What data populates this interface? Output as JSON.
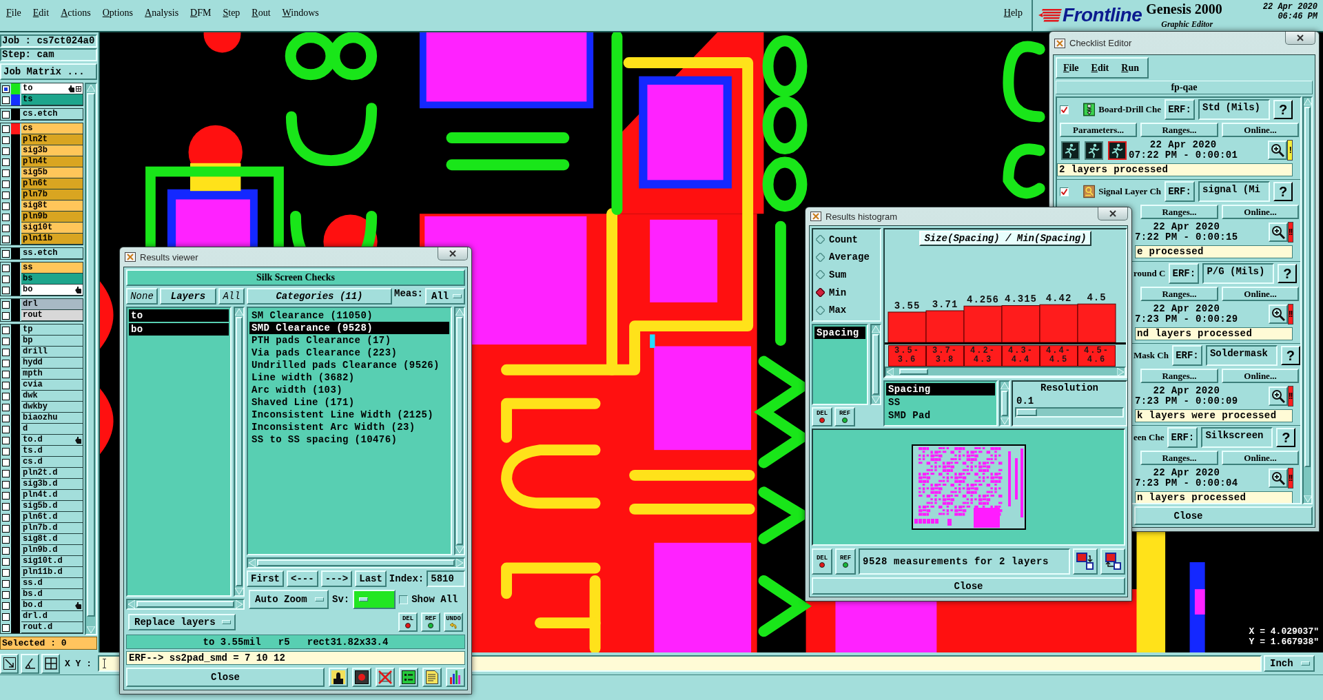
{
  "menu_bar": {
    "items": [
      "File",
      "Edit",
      "Actions",
      "Options",
      "Analysis",
      "DFM",
      "Step",
      "Rout",
      "Windows"
    ],
    "help": "Help"
  },
  "brand": {
    "logo": "Frontline",
    "product": "Genesis 2000",
    "subtitle": "Graphic Editor",
    "date": "22 Apr 2020",
    "time": "06:46 PM"
  },
  "job_panel": {
    "job": "Job : cs7ct024a0",
    "step": "Step: cam",
    "matrix_button": "Job Matrix ...",
    "layer_groups": [
      [
        {
          "name": "to",
          "work": true,
          "swatch": {
            "color": "#19e619"
          },
          "color": "#ffffff",
          "hand": true,
          "grid": true
        },
        {
          "name": "ts",
          "work": false,
          "swatch": {
            "color": "#1430ff"
          },
          "color": "#1ea58c",
          "hand": false,
          "grid": false
        }
      ],
      [
        {
          "name": "cs.etch",
          "work": false,
          "color": "#a3dedb",
          "hand": false,
          "grid": false
        }
      ],
      [
        {
          "name": "cs",
          "work": false,
          "swatch": {
            "color": "#ff1a1a"
          },
          "color": "#ffc65a",
          "hand": false,
          "grid": false
        },
        {
          "name": "pln2t",
          "work": false,
          "color": "#d9a521",
          "hand": false,
          "grid": false
        },
        {
          "name": "sig3b",
          "work": false,
          "color": "#ffc65a",
          "hand": false,
          "grid": false
        },
        {
          "name": "pln4t",
          "work": false,
          "color": "#d9a521",
          "hand": false,
          "grid": false
        },
        {
          "name": "sig5b",
          "work": false,
          "color": "#ffc65a",
          "hand": false,
          "grid": false
        },
        {
          "name": "pln6t",
          "work": false,
          "color": "#d9a521",
          "hand": false,
          "grid": false
        },
        {
          "name": "pln7b",
          "work": false,
          "color": "#d9a521",
          "hand": false,
          "grid": false
        },
        {
          "name": "sig8t",
          "work": false,
          "color": "#ffc65a",
          "hand": false,
          "grid": false
        },
        {
          "name": "pln9b",
          "work": false,
          "color": "#d9a521",
          "hand": false,
          "grid": false
        },
        {
          "name": "sig10t",
          "work": false,
          "color": "#ffc65a",
          "hand": false,
          "grid": false
        },
        {
          "name": "pln11b",
          "work": false,
          "color": "#d9a521",
          "hand": false,
          "grid": false
        }
      ],
      [
        {
          "name": "ss.etch",
          "work": false,
          "color": "#a3dedb",
          "hand": false,
          "grid": false
        }
      ],
      [
        {
          "name": "ss",
          "work": false,
          "color": "#ffc65a",
          "hand": false,
          "grid": false
        },
        {
          "name": "bs",
          "work": false,
          "color": "#1ea58c",
          "hand": false,
          "grid": false
        },
        {
          "name": "bo",
          "work": false,
          "color": "#ffffff",
          "hand": true,
          "grid": false
        }
      ],
      [
        {
          "name": "drl",
          "work": false,
          "color": "#a7b9c4",
          "hand": false,
          "grid": false
        },
        {
          "name": "rout",
          "work": false,
          "color": "#d8d8d8",
          "hand": false,
          "grid": false
        }
      ],
      [
        {
          "name": "tp",
          "work": false,
          "color": "#a3dedb",
          "hand": false,
          "grid": false
        },
        {
          "name": "bp",
          "work": false,
          "color": "#a3dedb",
          "hand": false,
          "grid": false
        },
        {
          "name": "drill",
          "work": false,
          "color": "#a3dedb",
          "hand": false,
          "grid": false
        },
        {
          "name": "hydd",
          "work": false,
          "color": "#a3dedb",
          "hand": false,
          "grid": false
        },
        {
          "name": "mpth",
          "work": false,
          "color": "#a3dedb",
          "hand": false,
          "grid": false
        },
        {
          "name": "cvia",
          "work": false,
          "color": "#a3dedb",
          "hand": false,
          "grid": false
        },
        {
          "name": "dwk",
          "work": false,
          "color": "#a3dedb",
          "hand": false,
          "grid": false
        },
        {
          "name": "dwkby",
          "work": false,
          "color": "#a3dedb",
          "hand": false,
          "grid": false
        },
        {
          "name": "biaozhu",
          "work": false,
          "color": "#a3dedb",
          "hand": false,
          "grid": false
        },
        {
          "name": "d",
          "work": false,
          "color": "#a3dedb",
          "hand": false,
          "grid": false
        },
        {
          "name": "to.d",
          "work": false,
          "color": "#a3dedb",
          "hand": true,
          "grid": false
        },
        {
          "name": "ts.d",
          "work": false,
          "color": "#a3dedb",
          "hand": false,
          "grid": false
        },
        {
          "name": "cs.d",
          "work": false,
          "color": "#a3dedb",
          "hand": false,
          "grid": false
        },
        {
          "name": "pln2t.d",
          "work": false,
          "color": "#a3dedb",
          "hand": false,
          "grid": false
        },
        {
          "name": "sig3b.d",
          "work": false,
          "color": "#a3dedb",
          "hand": false,
          "grid": false
        },
        {
          "name": "pln4t.d",
          "work": false,
          "color": "#a3dedb",
          "hand": false,
          "grid": false
        },
        {
          "name": "sig5b.d",
          "work": false,
          "color": "#a3dedb",
          "hand": false,
          "grid": false
        },
        {
          "name": "pln6t.d",
          "work": false,
          "color": "#a3dedb",
          "hand": false,
          "grid": false
        },
        {
          "name": "pln7b.d",
          "work": false,
          "color": "#a3dedb",
          "hand": false,
          "grid": false
        },
        {
          "name": "sig8t.d",
          "work": false,
          "color": "#a3dedb",
          "hand": false,
          "grid": false
        },
        {
          "name": "pln9b.d",
          "work": false,
          "color": "#a3dedb",
          "hand": false,
          "grid": false
        },
        {
          "name": "sig10t.d",
          "work": false,
          "color": "#a3dedb",
          "hand": false,
          "grid": false
        },
        {
          "name": "pln11b.d",
          "work": false,
          "color": "#a3dedb",
          "hand": false,
          "grid": false
        },
        {
          "name": "ss.d",
          "work": false,
          "color": "#a3dedb",
          "hand": false,
          "grid": false
        },
        {
          "name": "bs.d",
          "work": false,
          "color": "#a3dedb",
          "hand": false,
          "grid": false
        },
        {
          "name": "bo.d",
          "work": false,
          "color": "#a3dedb",
          "hand": true,
          "grid": false
        },
        {
          "name": "drl.d",
          "work": false,
          "color": "#a3dedb",
          "hand": false,
          "grid": false
        },
        {
          "name": "rout.d",
          "work": false,
          "color": "#a3dedb",
          "hand": false,
          "grid": false
        }
      ]
    ],
    "selected_count": "Selected : 0"
  },
  "canvas": {
    "x_readout": "X = 4.029037\"",
    "y_readout": "Y = 1.667938\""
  },
  "bottom_bar": {
    "xy_label": "X Y :",
    "units": "Inch"
  },
  "results_viewer": {
    "title": "Results viewer",
    "heading": "Silk Screen Checks",
    "none_button": "None",
    "layers_label": "Layers",
    "all_button": "All",
    "layers": [
      {
        "name": "to",
        "selected": true
      },
      {
        "name": "bo",
        "selected": true
      }
    ],
    "replace_mode": "Replace layers",
    "categories_label": "Categories (11)",
    "meas_label": "Meas:",
    "meas_value": "All",
    "categories": [
      {
        "label": "SM Clearance (11050)",
        "selected": false
      },
      {
        "label": "SMD Clearance (9528)",
        "selected": true
      },
      {
        "label": "PTH pads Clearance (17)",
        "selected": false
      },
      {
        "label": "Via pads Clearance (223)",
        "selected": false
      },
      {
        "label": "Undrilled pads Clearance (9526)",
        "selected": false
      },
      {
        "label": "Line width (3682)",
        "selected": false
      },
      {
        "label": "Arc width (103)",
        "selected": false
      },
      {
        "label": "Shaved Line (171)",
        "selected": false
      },
      {
        "label": "Inconsistent Line Width (2125)",
        "selected": false
      },
      {
        "label": "Inconsistent Arc Width (23)",
        "selected": false
      },
      {
        "label": "SS to SS spacing (10476)",
        "selected": false
      }
    ],
    "nav_buttons": [
      "First",
      "<---",
      "--->",
      "Last"
    ],
    "index_label": "Index:",
    "index_value": "5810",
    "zoom_mode": "Auto Zoom",
    "sv_label": "Sv:",
    "show_all": {
      "label": "Show All",
      "checked": false
    },
    "edit_buttons": [
      {
        "label": "DEL",
        "kind": "delete"
      },
      {
        "label": "REF",
        "kind": "refresh"
      },
      {
        "label": "UNDO",
        "kind": "undo"
      }
    ],
    "info": "to 3.55mil   r5   rect31.82x33.4",
    "erf": "ERF--> ss2pad_smd = 7 10 12",
    "close": "Close"
  },
  "histogram": {
    "title": "Results histogram",
    "modes": [
      {
        "label": "Count",
        "selected": false
      },
      {
        "label": "Average",
        "selected": false
      },
      {
        "label": "Sum",
        "selected": false
      },
      {
        "label": "Min",
        "selected": true
      },
      {
        "label": "Max",
        "selected": false
      }
    ],
    "measures": [
      {
        "label": "Spacing",
        "selected": true
      }
    ],
    "measure_buttons": [
      {
        "label": "DEL",
        "kind": "delete"
      },
      {
        "label": "REF",
        "kind": "refresh"
      }
    ],
    "chart_data": {
      "type": "bar",
      "title": "Size(Spacing) / Min(Spacing)",
      "categories": [
        "3.5-3.6",
        "3.7-3.8",
        "4.2-4.3",
        "4.3-4.4",
        "4.4-4.5",
        "4.5-4.6"
      ],
      "values": [
        3.55,
        3.71,
        4.256,
        4.315,
        4.42,
        4.5
      ],
      "data_labels": true
    },
    "fields": [
      {
        "label": "Spacing",
        "selected": true
      },
      {
        "label": "SS",
        "selected": false
      },
      {
        "label": "SMD Pad",
        "selected": false
      }
    ],
    "resolution": {
      "label": "Resolution",
      "value": "0.1",
      "level": 0
    },
    "summary_buttons": [
      {
        "label": "DEL",
        "kind": "delete"
      },
      {
        "label": "REF",
        "kind": "refresh"
      }
    ],
    "summary": "9528 measurements for 2 layers",
    "close": "Close"
  },
  "checklist": {
    "title": "Checklist Editor",
    "menu": [
      "File",
      "Edit",
      "Run"
    ],
    "name": "fp-qae",
    "checks": [
      {
        "checked": true,
        "title": "Board-Drill Che",
        "erf_label": "ERF:",
        "erf_value": "Std (Mils)",
        "help": "?",
        "buttons": [
          "Parameters...",
          "Ranges...",
          "Online..."
        ],
        "date": "22 Apr 2020",
        "time": "07:22 PM - 0:00:01",
        "flag": "!",
        "color": "#f5ee3a",
        "status": "2 layers processed"
      },
      {
        "checked": true,
        "title": "Signal Layer Ch",
        "erf_label": "ERF:",
        "erf_value": "signal (Mi",
        "help": "?",
        "buttons": [
          "Ranges...",
          "Online..."
        ],
        "date": "22 Apr 2020",
        "time": "7:22 PM - 0:00:15",
        "flag": "!!",
        "color": "#ff1e1e",
        "status": "e processed"
      },
      {
        "title": "round C",
        "erf_label": "ERF:",
        "erf_value": "P/G (Mils)",
        "help": "?",
        "buttons": [
          "Ranges...",
          "Online..."
        ],
        "date": "22 Apr 2020",
        "time": "7:23 PM - 0:00:29",
        "flag": "!!",
        "color": "#ff1e1e",
        "status": "nd layers processed"
      },
      {
        "title": "Mask Ch",
        "erf_label": "ERF:",
        "erf_value": "Soldermask",
        "help": "?",
        "buttons": [
          "Ranges...",
          "Online..."
        ],
        "date": "22 Apr 2020",
        "time": "7:23 PM - 0:00:09",
        "flag": "!!",
        "color": "#ff1e1e",
        "status": "k layers were processed"
      },
      {
        "title": "een Che",
        "erf_label": "ERF:",
        "erf_value": "Silkscreen",
        "help": "?",
        "buttons": [
          "Ranges...",
          "Online..."
        ],
        "date": "22 Apr 2020",
        "time": "7:23 PM - 0:00:04",
        "flag": "!!",
        "color": "#ff1e1e",
        "status": "n layers processed"
      }
    ],
    "close": "Close"
  }
}
